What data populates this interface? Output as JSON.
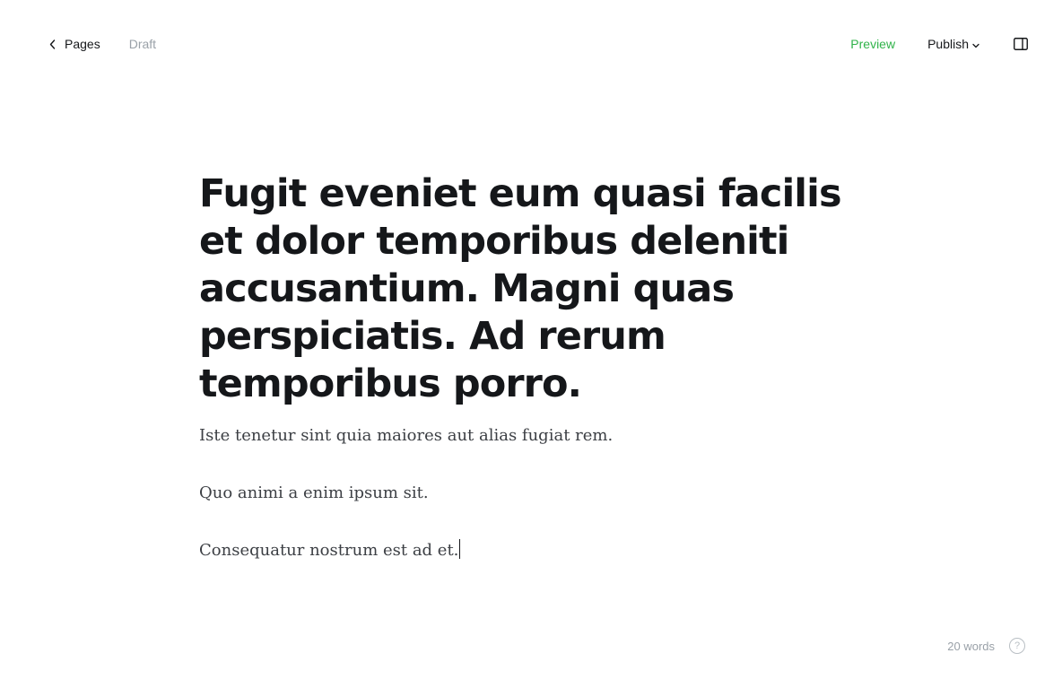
{
  "header": {
    "back_label": "Pages",
    "status": "Draft",
    "preview_label": "Preview",
    "publish_label": "Publish"
  },
  "post": {
    "title": "Fugit eveniet eum quasi facilis et dolor temporibus deleniti accusantium. Magni quas perspiciatis. Ad rerum temporibus porro.",
    "paragraphs": [
      "Iste tenetur sint quia maiores aut alias fugiat rem.",
      "Quo animi a enim ipsum sit.",
      "Consequatur nostrum est ad et."
    ]
  },
  "footer": {
    "word_count": "20 words",
    "help_label": "?"
  },
  "colors": {
    "accent_green": "#30b34a",
    "text_dark": "#15171a",
    "text_muted": "#9aa1a8"
  },
  "icons": {
    "back": "chevron-left-icon",
    "publish_caret": "chevron-down-icon",
    "sidebar": "sidebar-toggle-icon",
    "help": "help-icon"
  }
}
